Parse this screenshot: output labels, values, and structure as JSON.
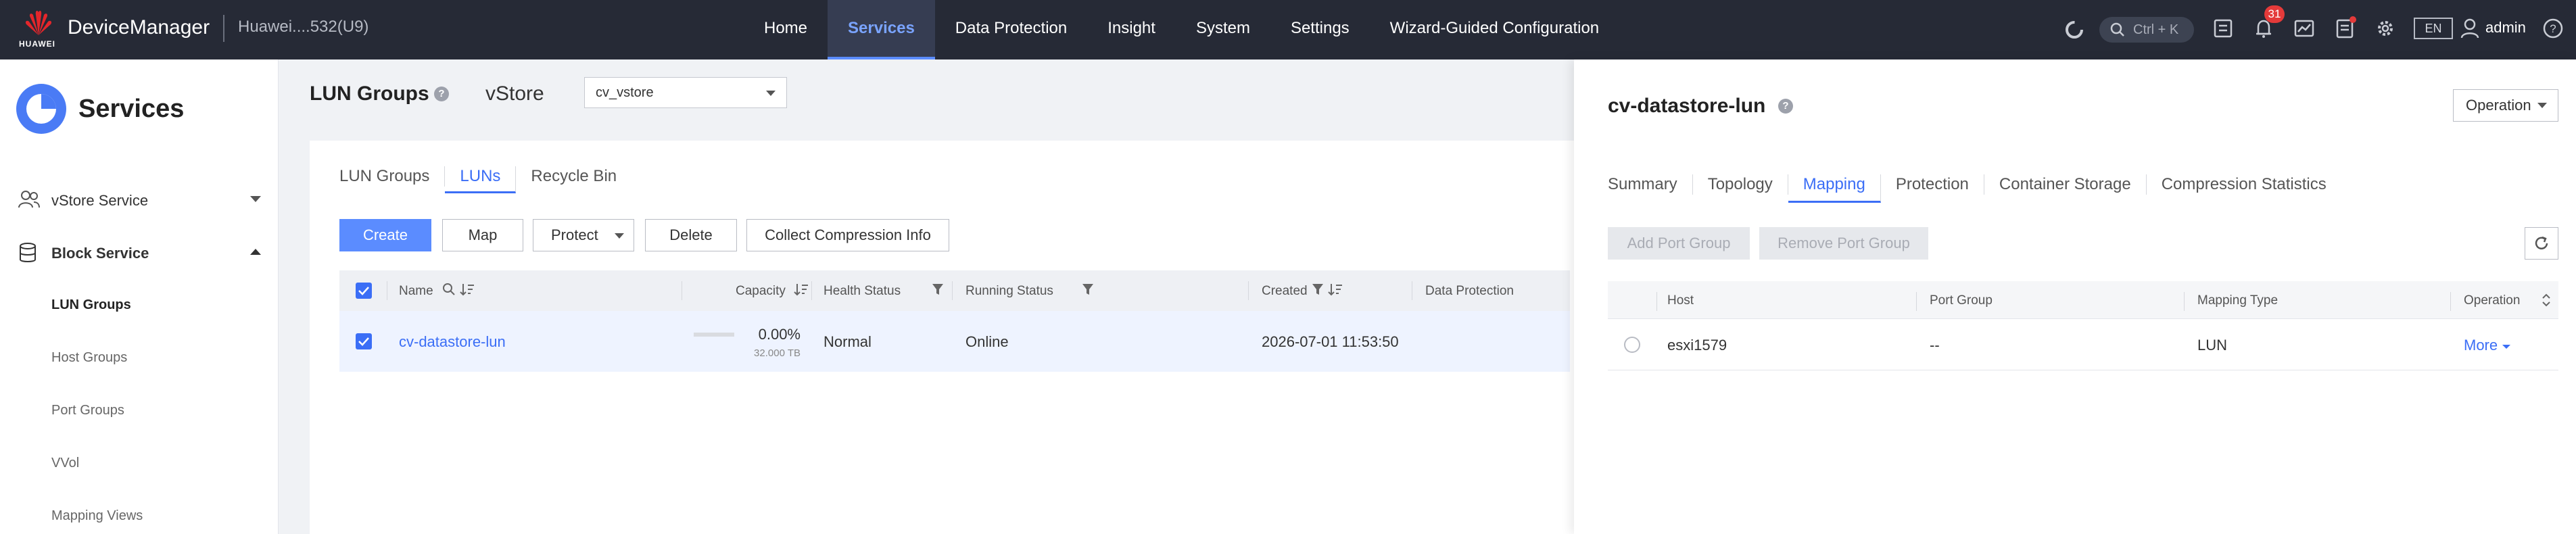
{
  "header": {
    "brand_logo_text": "HUAWEI",
    "app_name": "DeviceManager",
    "device_name": "Huawei....532(U9)",
    "nav": [
      {
        "label": "Home"
      },
      {
        "label": "Services"
      },
      {
        "label": "Data Protection"
      },
      {
        "label": "Insight"
      },
      {
        "label": "System"
      },
      {
        "label": "Settings"
      },
      {
        "label": "Wizard-Guided Configuration"
      }
    ],
    "search_shortcut": "Ctrl + K",
    "alarm_count": "31",
    "language": "EN",
    "user": "admin",
    "active_nav_color": "#7aa4ff"
  },
  "sidebar": {
    "title": "Services",
    "groups": [
      {
        "label": "vStore Service"
      },
      {
        "label": "Block Service"
      }
    ],
    "items": [
      {
        "label": "LUN Groups"
      },
      {
        "label": "Host Groups"
      },
      {
        "label": "Port Groups"
      },
      {
        "label": "VVol"
      },
      {
        "label": "Mapping Views"
      }
    ]
  },
  "main": {
    "title": "LUN Groups",
    "vstore_label": "vStore",
    "vstore_value": "cv_vstore",
    "tabs": [
      {
        "label": "LUN Groups"
      },
      {
        "label": "LUNs"
      },
      {
        "label": "Recycle Bin"
      }
    ],
    "toolbar": {
      "create": "Create",
      "map": "Map",
      "protect": "Protect",
      "delete": "Delete",
      "collect": "Collect Compression Info"
    },
    "columns": {
      "name": "Name",
      "capacity": "Capacity",
      "health": "Health Status",
      "running": "Running Status",
      "created": "Created",
      "protection": "Data Protection"
    },
    "rows": [
      {
        "name": "cv-datastore-lun",
        "capacity_pct": "0.00%",
        "capacity_total": "32.000 TB",
        "health": "Normal",
        "running": "Online",
        "created": "2026-07-01 11:53:50"
      }
    ]
  },
  "panel": {
    "title": "cv-datastore-lun",
    "operation": "Operation",
    "tabs": [
      {
        "label": "Summary"
      },
      {
        "label": "Topology"
      },
      {
        "label": "Mapping"
      },
      {
        "label": "Protection"
      },
      {
        "label": "Container Storage"
      },
      {
        "label": "Compression Statistics"
      }
    ],
    "buttons": {
      "add_port_group": "Add Port Group",
      "remove_port_group": "Remove Port Group"
    },
    "columns": {
      "host": "Host",
      "port_group": "Port Group",
      "mapping_type": "Mapping Type",
      "operation": "Operation"
    },
    "rows": [
      {
        "host": "esxi1579",
        "port_group": "--",
        "mapping_type": "LUN",
        "operation": "More"
      }
    ]
  }
}
